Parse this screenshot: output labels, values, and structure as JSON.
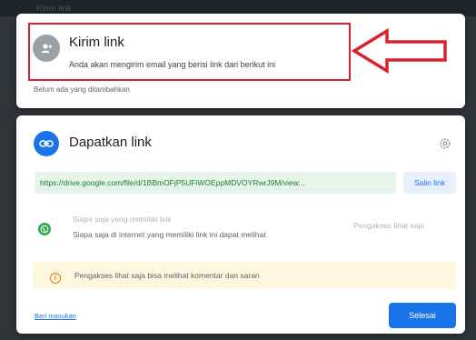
{
  "background": {
    "ghost_text": "Kirim link"
  },
  "send_link": {
    "title": "Kirim link",
    "description": "Anda akan mengirim email yang berisi link dari berikut ini",
    "subtext": "Belum ada yang ditambahkan",
    "icon": "person-add-icon"
  },
  "get_link": {
    "title": "Dapatkan link",
    "icon": "link-icon",
    "settings_icon": "gear-icon",
    "url": "https://drive.google.com/file/d/1BBmOFjP5UFiWOEppMDVOYRwrJ9M/view...",
    "copy_label": "Salin link",
    "access_title": "Siapa saja yang memiliki link",
    "access_desc": "Siapa saja di internet yang memiliki link ini dapat melihat",
    "role_label": "Pengakses lihat saja",
    "info_text": "Pengakses lihat saja bisa melihat komentar dan saran",
    "feedback_label": "Beri masukan",
    "done_label": "Selesai"
  },
  "annotation": {
    "highlight_color": "#d6222e",
    "arrow_color": "#d6222e"
  },
  "colors": {
    "accent": "#1a73e8",
    "link_green": "#188038",
    "link_bg": "#e6f4ea",
    "info_bg": "#fef7e0"
  }
}
